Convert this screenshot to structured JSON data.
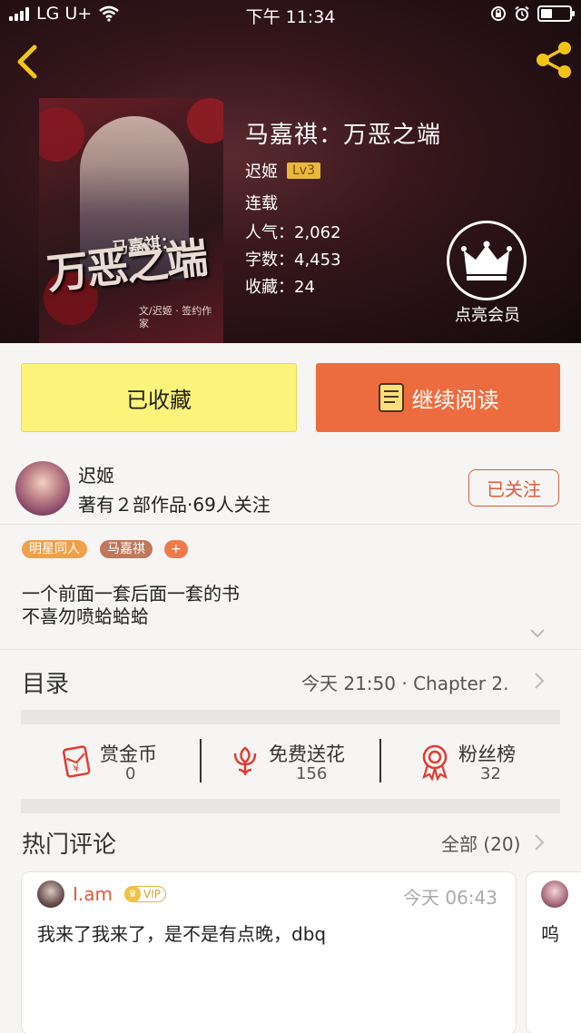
{
  "status_bar": {
    "carrier": "LG U+",
    "time": "下午 11:34"
  },
  "book": {
    "title": "马嘉祺：万恶之端",
    "author": "迟姬",
    "level": "Lv3",
    "status": "连载",
    "popularity": "人气：2,062",
    "word_count": "字数：4,453",
    "favorites": "收藏：24",
    "vip_label": "点亮会员",
    "cover_text_main": "万恶之端",
    "cover_text_sub": "马嘉祺：",
    "cover_text_small": "文/迟姬 · 签约作家"
  },
  "actions": {
    "collected_label": "已收藏",
    "continue_label": "继续阅读"
  },
  "author_info": {
    "name": "迟姬",
    "stats": "著有２部作品·69人关注",
    "follow_label": "已关注"
  },
  "tags": [
    "明星同人",
    "马嘉祺",
    "+"
  ],
  "description": {
    "line1": "一个前面一套后面一套的书",
    "line2": "不喜勿喷蛤蛤蛤"
  },
  "toc": {
    "title": "目录",
    "latest": "今天 21:50 · Chapter 2."
  },
  "stats": [
    {
      "label": "赏金币",
      "value": "0",
      "icon": "red-envelope-icon"
    },
    {
      "label": "免费送花",
      "value": "156",
      "icon": "flower-icon"
    },
    {
      "label": "粉丝榜",
      "value": "32",
      "icon": "medal-icon"
    }
  ],
  "comments": {
    "title": "热门评论",
    "all_label": "全部 (20)",
    "items": [
      {
        "user": "I.am",
        "badge": "VIP",
        "time": "今天 06:43",
        "text": "我来了我来了，是不是有点晚，dbq"
      },
      {
        "text": "呜"
      }
    ]
  },
  "colors": {
    "accent_orange": "#ed6c3f",
    "collected_yellow": "#fbf37a",
    "follow_red": "#e05a3a",
    "lv_gold": "#e9b93c"
  }
}
